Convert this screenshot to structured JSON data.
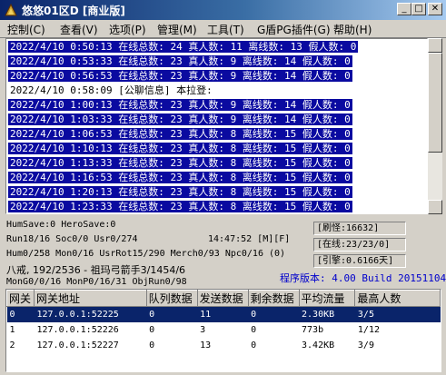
{
  "window": {
    "title": "悠悠01区D [商业版]",
    "minimize_label": "_",
    "maximize_label": "□",
    "close_label": "✕"
  },
  "menu": {
    "items": [
      {
        "label": "控制(C)"
      },
      {
        "label": "查看(V)"
      },
      {
        "label": "选项(P)"
      },
      {
        "label": "管理(M)"
      },
      {
        "label": "工具(T)"
      },
      {
        "label": "G盾PG插件(G)"
      },
      {
        "label": "帮助(H)"
      }
    ]
  },
  "log": {
    "lines": [
      {
        "text": "2022/4/10 0:50:13 在线总数: 24 真人数: 11 离线数: 13 假人数: 0",
        "selected": true
      },
      {
        "text": "2022/4/10 0:53:33 在线总数: 23 真人数: 9 离线数: 14 假人数: 0",
        "selected": true
      },
      {
        "text": "2022/4/10 0:56:53 在线总数: 23 真人数: 9 离线数: 14 假人数: 0",
        "selected": true
      },
      {
        "text": "2022/4/10 0:58:09 [公聊信息] 本拉登:",
        "selected": false
      },
      {
        "text": "2022/4/10 1:00:13 在线总数: 23 真人数: 9 离线数: 14 假人数: 0",
        "selected": true
      },
      {
        "text": "2022/4/10 1:03:33 在线总数: 23 真人数: 9 离线数: 14 假人数: 0",
        "selected": true
      },
      {
        "text": "2022/4/10 1:06:53 在线总数: 23 真人数: 8 离线数: 15 假人数: 0",
        "selected": true
      },
      {
        "text": "2022/4/10 1:10:13 在线总数: 23 真人数: 8 离线数: 15 假人数: 0",
        "selected": true
      },
      {
        "text": "2022/4/10 1:13:33 在线总数: 23 真人数: 8 离线数: 15 假人数: 0",
        "selected": true
      },
      {
        "text": "2022/4/10 1:16:53 在线总数: 23 真人数: 8 离线数: 15 假人数: 0",
        "selected": true
      },
      {
        "text": "2022/4/10 1:20:13 在线总数: 23 真人数: 8 离线数: 15 假人数: 0",
        "selected": true
      },
      {
        "text": "2022/4/10 1:23:33 在线总数: 23 真人数: 8 离线数: 15 假人数: 0",
        "selected": true
      }
    ]
  },
  "status": {
    "line1": "HumSave:0 HeroSave:0",
    "line2": "Run18/16 Soc0/0 Usr0/274",
    "clock": "14:47:52 [M][F]",
    "line3": "Hum0/258 Mon0/16 UsrRot15/290 Merch0/93 Npc0/16 (0)",
    "line4": "八戒, 192/2536 - 祖玛弓箭手3/1454/6",
    "line5": "MonG0/0/16 MonP0/16/31 ObjRun0/98",
    "refresh": "[刷怪:16632]",
    "online": "[在线:23/23/0]",
    "engine": "[引擎:0.6166天]",
    "version": "程序版本: 4.00 Build 20151104"
  },
  "grid": {
    "headers": [
      "网关",
      "网关地址",
      "队列数据",
      "发送数据",
      "剩余数据",
      "平均流量",
      "最高人数"
    ],
    "rows": [
      [
        "0",
        "127.0.0.1:52225",
        "0",
        "11",
        "0",
        "2.30KB",
        "3/5"
      ],
      [
        "1",
        "127.0.0.1:52226",
        "0",
        "3",
        "0",
        "773b",
        "1/12"
      ],
      [
        "2",
        "127.0.0.1:52227",
        "0",
        "13",
        "0",
        "3.42KB",
        "3/9"
      ]
    ],
    "selected_row": 0
  }
}
